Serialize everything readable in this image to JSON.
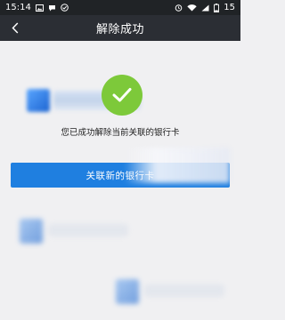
{
  "status_bar": {
    "time": "15:14",
    "battery": "15",
    "left_icons": [
      "image-icon",
      "chat-icon",
      "check-circle-icon"
    ],
    "right_icons": [
      "alarm-icon",
      "wifi-icon",
      "signal-icon",
      "battery-icon"
    ]
  },
  "nav": {
    "title": "解除成功",
    "back_icon": "chevron-left-icon"
  },
  "result": {
    "icon": "checkmark-icon",
    "icon_color": "#7dc93a",
    "message": "您已成功解除当前关联的银行卡"
  },
  "action": {
    "relink_label": "关联新的银行卡",
    "button_color": "#1f7fe0"
  }
}
